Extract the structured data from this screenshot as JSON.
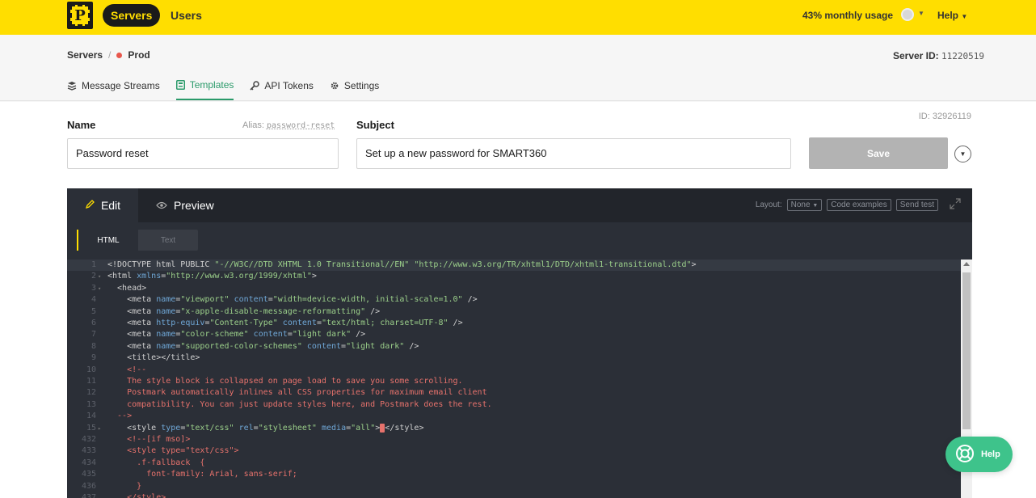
{
  "topbar": {
    "logo_letter": "P",
    "nav": [
      {
        "label": "Servers",
        "active": true
      },
      {
        "label": "Users",
        "active": false
      }
    ],
    "usage": "43% monthly usage",
    "help_label": "Help"
  },
  "server": {
    "breadcrumb_root": "Servers",
    "breadcrumb_sep": "/",
    "name": "Prod",
    "status_color": "#e8574c",
    "id_label": "Server ID:",
    "id_value": "11220519"
  },
  "tabs": [
    {
      "label": "Message Streams",
      "icon": "layers-icon",
      "active": false
    },
    {
      "label": "Templates",
      "icon": "template-icon",
      "active": true
    },
    {
      "label": "API Tokens",
      "icon": "key-icon",
      "active": false
    },
    {
      "label": "Settings",
      "icon": "gear-icon",
      "active": false
    }
  ],
  "form": {
    "name_label": "Name",
    "alias_label": "Alias:",
    "alias_value": "password-reset",
    "subject_label": "Subject",
    "template_id": "ID: 32926119",
    "name_value": "Password reset",
    "subject_value": "Set up a new password for SMART360",
    "save_label": "Save"
  },
  "editor": {
    "tab_edit": "Edit",
    "tab_preview": "Preview",
    "layout_label": "Layout:",
    "layout_value": "None",
    "code_examples": "Code examples",
    "send_test": "Send test",
    "subtab_html": "HTML",
    "subtab_text": "Text",
    "lines": [
      {
        "n": "1",
        "fold": "",
        "hl": true,
        "parts": [
          [
            "tag",
            "<!DOCTYPE html PUBLIC "
          ],
          [
            "str",
            "\"-//W3C//DTD XHTML 1.0 Transitional//EN\""
          ],
          [
            "tag",
            " "
          ],
          [
            "str",
            "\"http://www.w3.org/TR/xhtml1/DTD/xhtml1-transitional.dtd\""
          ],
          [
            "tag",
            ">"
          ]
        ]
      },
      {
        "n": "2",
        "fold": "▾",
        "parts": [
          [
            "tag",
            "<html "
          ],
          [
            "attr",
            "xmlns"
          ],
          [
            "tag",
            "="
          ],
          [
            "str",
            "\"http://www.w3.org/1999/xhtml\""
          ],
          [
            "tag",
            ">"
          ]
        ]
      },
      {
        "n": "3",
        "fold": "▾",
        "parts": [
          [
            "tag",
            "  <head>"
          ]
        ]
      },
      {
        "n": "4",
        "fold": "",
        "parts": [
          [
            "tag",
            "    <meta "
          ],
          [
            "attr",
            "name"
          ],
          [
            "tag",
            "="
          ],
          [
            "str",
            "\"viewport\""
          ],
          [
            "tag",
            " "
          ],
          [
            "attr",
            "content"
          ],
          [
            "tag",
            "="
          ],
          [
            "str",
            "\"width=device-width, initial-scale=1.0\""
          ],
          [
            "tag",
            " />"
          ]
        ]
      },
      {
        "n": "5",
        "fold": "",
        "parts": [
          [
            "tag",
            "    <meta "
          ],
          [
            "attr",
            "name"
          ],
          [
            "tag",
            "="
          ],
          [
            "str",
            "\"x-apple-disable-message-reformatting\""
          ],
          [
            "tag",
            " />"
          ]
        ]
      },
      {
        "n": "6",
        "fold": "",
        "parts": [
          [
            "tag",
            "    <meta "
          ],
          [
            "attr",
            "http-equiv"
          ],
          [
            "tag",
            "="
          ],
          [
            "str",
            "\"Content-Type\""
          ],
          [
            "tag",
            " "
          ],
          [
            "attr",
            "content"
          ],
          [
            "tag",
            "="
          ],
          [
            "str",
            "\"text/html; charset=UTF-8\""
          ],
          [
            "tag",
            " />"
          ]
        ]
      },
      {
        "n": "7",
        "fold": "",
        "parts": [
          [
            "tag",
            "    <meta "
          ],
          [
            "attr",
            "name"
          ],
          [
            "tag",
            "="
          ],
          [
            "str",
            "\"color-scheme\""
          ],
          [
            "tag",
            " "
          ],
          [
            "attr",
            "content"
          ],
          [
            "tag",
            "="
          ],
          [
            "str",
            "\"light dark\""
          ],
          [
            "tag",
            " />"
          ]
        ]
      },
      {
        "n": "8",
        "fold": "",
        "parts": [
          [
            "tag",
            "    <meta "
          ],
          [
            "attr",
            "name"
          ],
          [
            "tag",
            "="
          ],
          [
            "str",
            "\"supported-color-schemes\""
          ],
          [
            "tag",
            " "
          ],
          [
            "attr",
            "content"
          ],
          [
            "tag",
            "="
          ],
          [
            "str",
            "\"light dark\""
          ],
          [
            "tag",
            " />"
          ]
        ]
      },
      {
        "n": "9",
        "fold": "",
        "parts": [
          [
            "tag",
            "    <title></title>"
          ]
        ]
      },
      {
        "n": "10",
        "fold": "",
        "parts": [
          [
            "cmt",
            "    <!--"
          ]
        ]
      },
      {
        "n": "11",
        "fold": "",
        "parts": [
          [
            "cmt",
            "    The style block is collapsed on page load to save you some scrolling."
          ]
        ]
      },
      {
        "n": "12",
        "fold": "",
        "parts": [
          [
            "cmt",
            "    Postmark automatically inlines all CSS properties for maximum email client"
          ]
        ]
      },
      {
        "n": "13",
        "fold": "",
        "parts": [
          [
            "cmt",
            "    compatibility. You can just update styles here, and Postmark does the rest."
          ]
        ]
      },
      {
        "n": "14",
        "fold": "",
        "parts": [
          [
            "cmt",
            "  -->"
          ]
        ]
      },
      {
        "n": "15",
        "fold": "▸",
        "parts": [
          [
            "tag",
            "    <style "
          ],
          [
            "attr",
            "type"
          ],
          [
            "tag",
            "="
          ],
          [
            "str",
            "\"text/css\""
          ],
          [
            "tag",
            " "
          ],
          [
            "attr",
            "rel"
          ],
          [
            "tag",
            "="
          ],
          [
            "str",
            "\"stylesheet\""
          ],
          [
            "tag",
            " "
          ],
          [
            "attr",
            "media"
          ],
          [
            "tag",
            "="
          ],
          [
            "str",
            "\"all\""
          ],
          [
            "tag",
            ">"
          ],
          [
            "fold",
            "↔"
          ],
          [
            "tag",
            "</style>"
          ]
        ]
      },
      {
        "n": "432",
        "fold": "",
        "parts": [
          [
            "cmt",
            "    <!--[if mso]>"
          ]
        ]
      },
      {
        "n": "433",
        "fold": "",
        "parts": [
          [
            "cmt",
            "    <style type=\"text/css\">"
          ]
        ]
      },
      {
        "n": "434",
        "fold": "",
        "parts": [
          [
            "cmt",
            "      .f-fallback  {"
          ]
        ]
      },
      {
        "n": "435",
        "fold": "",
        "parts": [
          [
            "cmt",
            "        font-family: Arial, sans-serif;"
          ]
        ]
      },
      {
        "n": "436",
        "fold": "",
        "parts": [
          [
            "cmt",
            "      }"
          ]
        ]
      },
      {
        "n": "437",
        "fold": "",
        "parts": [
          [
            "cmt",
            "    </style>"
          ]
        ]
      }
    ]
  },
  "help_fab": {
    "label": "Help",
    "icon": "lifebuoy-icon"
  }
}
